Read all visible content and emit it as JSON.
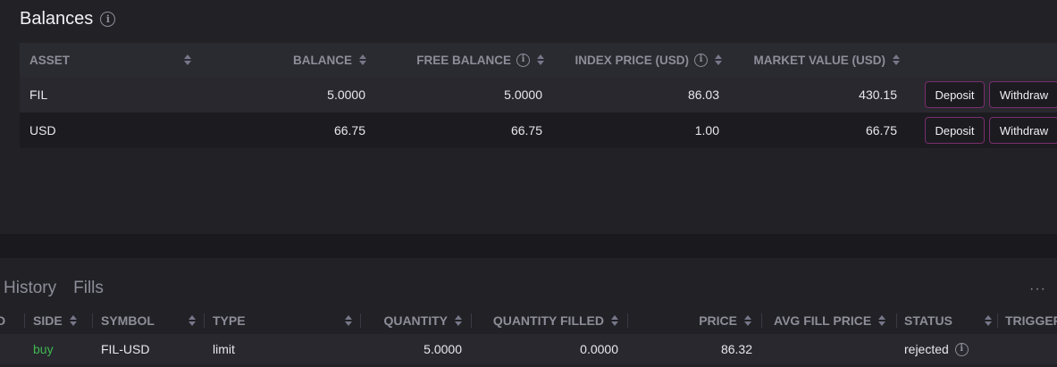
{
  "balances": {
    "title": "Balances",
    "columns": {
      "asset": "ASSET",
      "balance": "BALANCE",
      "free_balance": "FREE BALANCE",
      "index_price": "INDEX PRICE (USD)",
      "market_value": "MARKET VALUE (USD)"
    },
    "rows": [
      {
        "asset": "FIL",
        "balance": "5.0000",
        "free_balance": "5.0000",
        "index_price": "86.03",
        "market_value": "430.15",
        "deposit": "Deposit",
        "withdraw": "Withdraw"
      },
      {
        "asset": "USD",
        "balance": "66.75",
        "free_balance": "66.75",
        "index_price": "1.00",
        "market_value": "66.75",
        "deposit": "Deposit",
        "withdraw": "Withdraw"
      }
    ]
  },
  "orders": {
    "tabs": [
      "History",
      "Fills"
    ],
    "more_label": "···",
    "columns": {
      "id_partial": "D",
      "side": "SIDE",
      "symbol": "SYMBOL",
      "type": "TYPE",
      "quantity": "QUANTITY",
      "quantity_filled": "QUANTITY FILLED",
      "price": "PRICE",
      "avg_fill_price": "AVG FILL PRICE",
      "status": "STATUS",
      "trigger": "TRIGGER"
    },
    "rows": [
      {
        "side": "buy",
        "symbol": "FIL-USD",
        "type": "limit",
        "quantity": "5.0000",
        "quantity_filled": "0.0000",
        "price": "86.32",
        "avg_fill_price": "",
        "status": "rejected"
      }
    ]
  },
  "colors": {
    "accent_border": "#7a2d6e",
    "buy": "#3fb950",
    "bg": "#212126"
  },
  "icons": {
    "info": "info-circle-icon",
    "sort": "sort-arrows-icon",
    "more": "more-horizontal-icon"
  }
}
